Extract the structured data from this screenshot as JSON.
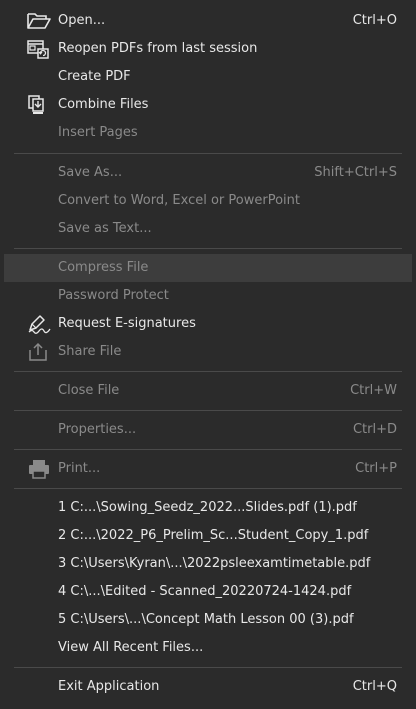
{
  "menu": {
    "open": {
      "label": "Open...",
      "shortcut": "Ctrl+O"
    },
    "reopen": {
      "label": "Reopen PDFs from last session"
    },
    "create_pdf": {
      "label": "Create PDF"
    },
    "combine": {
      "label": "Combine Files"
    },
    "insert_pages": {
      "label": "Insert Pages"
    },
    "save_as": {
      "label": "Save As...",
      "shortcut": "Shift+Ctrl+S"
    },
    "convert": {
      "label": "Convert to Word, Excel or PowerPoint"
    },
    "save_text": {
      "label": "Save as Text..."
    },
    "compress": {
      "label": "Compress File"
    },
    "password": {
      "label": "Password Protect"
    },
    "esign": {
      "label": "Request E-signatures"
    },
    "share": {
      "label": "Share File"
    },
    "close": {
      "label": "Close File",
      "shortcut": "Ctrl+W"
    },
    "properties": {
      "label": "Properties...",
      "shortcut": "Ctrl+D"
    },
    "print": {
      "label": "Print...",
      "shortcut": "Ctrl+P"
    },
    "recent": [
      {
        "num": "1",
        "label": "C:...\\Sowing_Seedz_2022...Slides.pdf (1).pdf"
      },
      {
        "num": "2",
        "label": "C:...\\2022_P6_Prelim_Sc...Student_Copy_1.pdf"
      },
      {
        "num": "3",
        "label": "C:\\Users\\Kyran\\...\\2022psleexamtimetable.pdf"
      },
      {
        "num": "4",
        "label": "C:\\...\\Edited - Scanned_20220724-1424.pdf"
      },
      {
        "num": "5",
        "label": "C:\\Users\\...\\Concept Math Lesson 00 (3).pdf"
      }
    ],
    "view_all_recent": {
      "label": "View All Recent Files..."
    },
    "exit": {
      "label": "Exit Application",
      "shortcut": "Ctrl+Q"
    }
  },
  "icons": {
    "open": "folder-open-icon",
    "reopen": "reopen-files-icon",
    "combine": "combine-files-icon",
    "esign": "signature-pen-icon",
    "share": "share-upload-icon",
    "print": "printer-icon"
  },
  "colors": {
    "background": "#2b2b2b",
    "text": "#e8e8e8",
    "disabled_text": "#8a8a8a",
    "separator": "#4a4a4a",
    "highlight": "#3d3d3d"
  }
}
